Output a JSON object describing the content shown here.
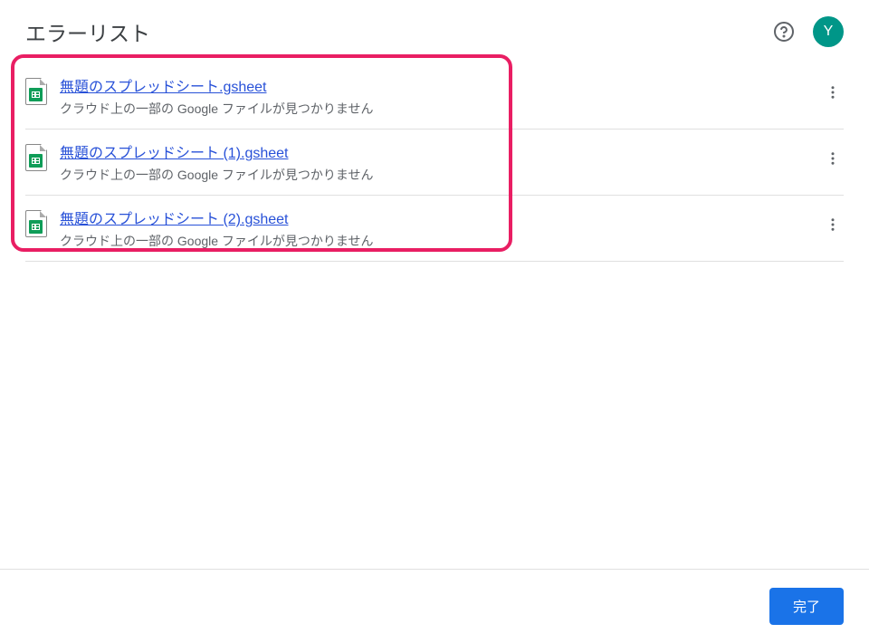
{
  "header": {
    "title": "エラーリスト",
    "avatar_letter": "Y"
  },
  "errors": [
    {
      "filename": "無題のスプレッドシート.gsheet",
      "message": "クラウド上の一部の Google ファイルが見つかりません"
    },
    {
      "filename": "無題のスプレッドシート (1).gsheet",
      "message": "クラウド上の一部の Google ファイルが見つかりません"
    },
    {
      "filename": "無題のスプレッドシート (2).gsheet",
      "message": "クラウド上の一部の Google ファイルが見つかりません"
    }
  ],
  "footer": {
    "done_label": "完了"
  }
}
